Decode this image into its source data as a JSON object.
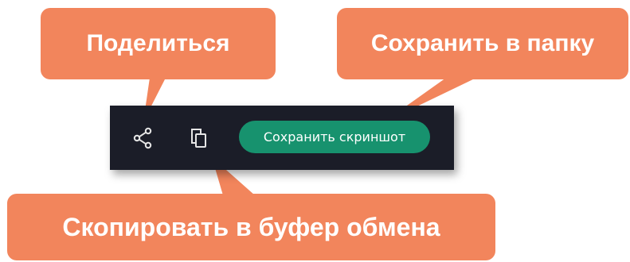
{
  "callouts": {
    "share": "Поделиться",
    "save_to_folder": "Сохранить в папку",
    "copy_to_clipboard": "Скопировать в буфер обмена"
  },
  "toolbar": {
    "share_icon": "share-icon",
    "copy_icon": "copy-icon",
    "save_button_label": "Сохранить скриншот"
  },
  "colors": {
    "callout": "#f2855c",
    "toolbar_bg": "#1b1d28",
    "save_button": "#17926e",
    "icon": "#e6e6e6",
    "text": "#ffffff"
  }
}
